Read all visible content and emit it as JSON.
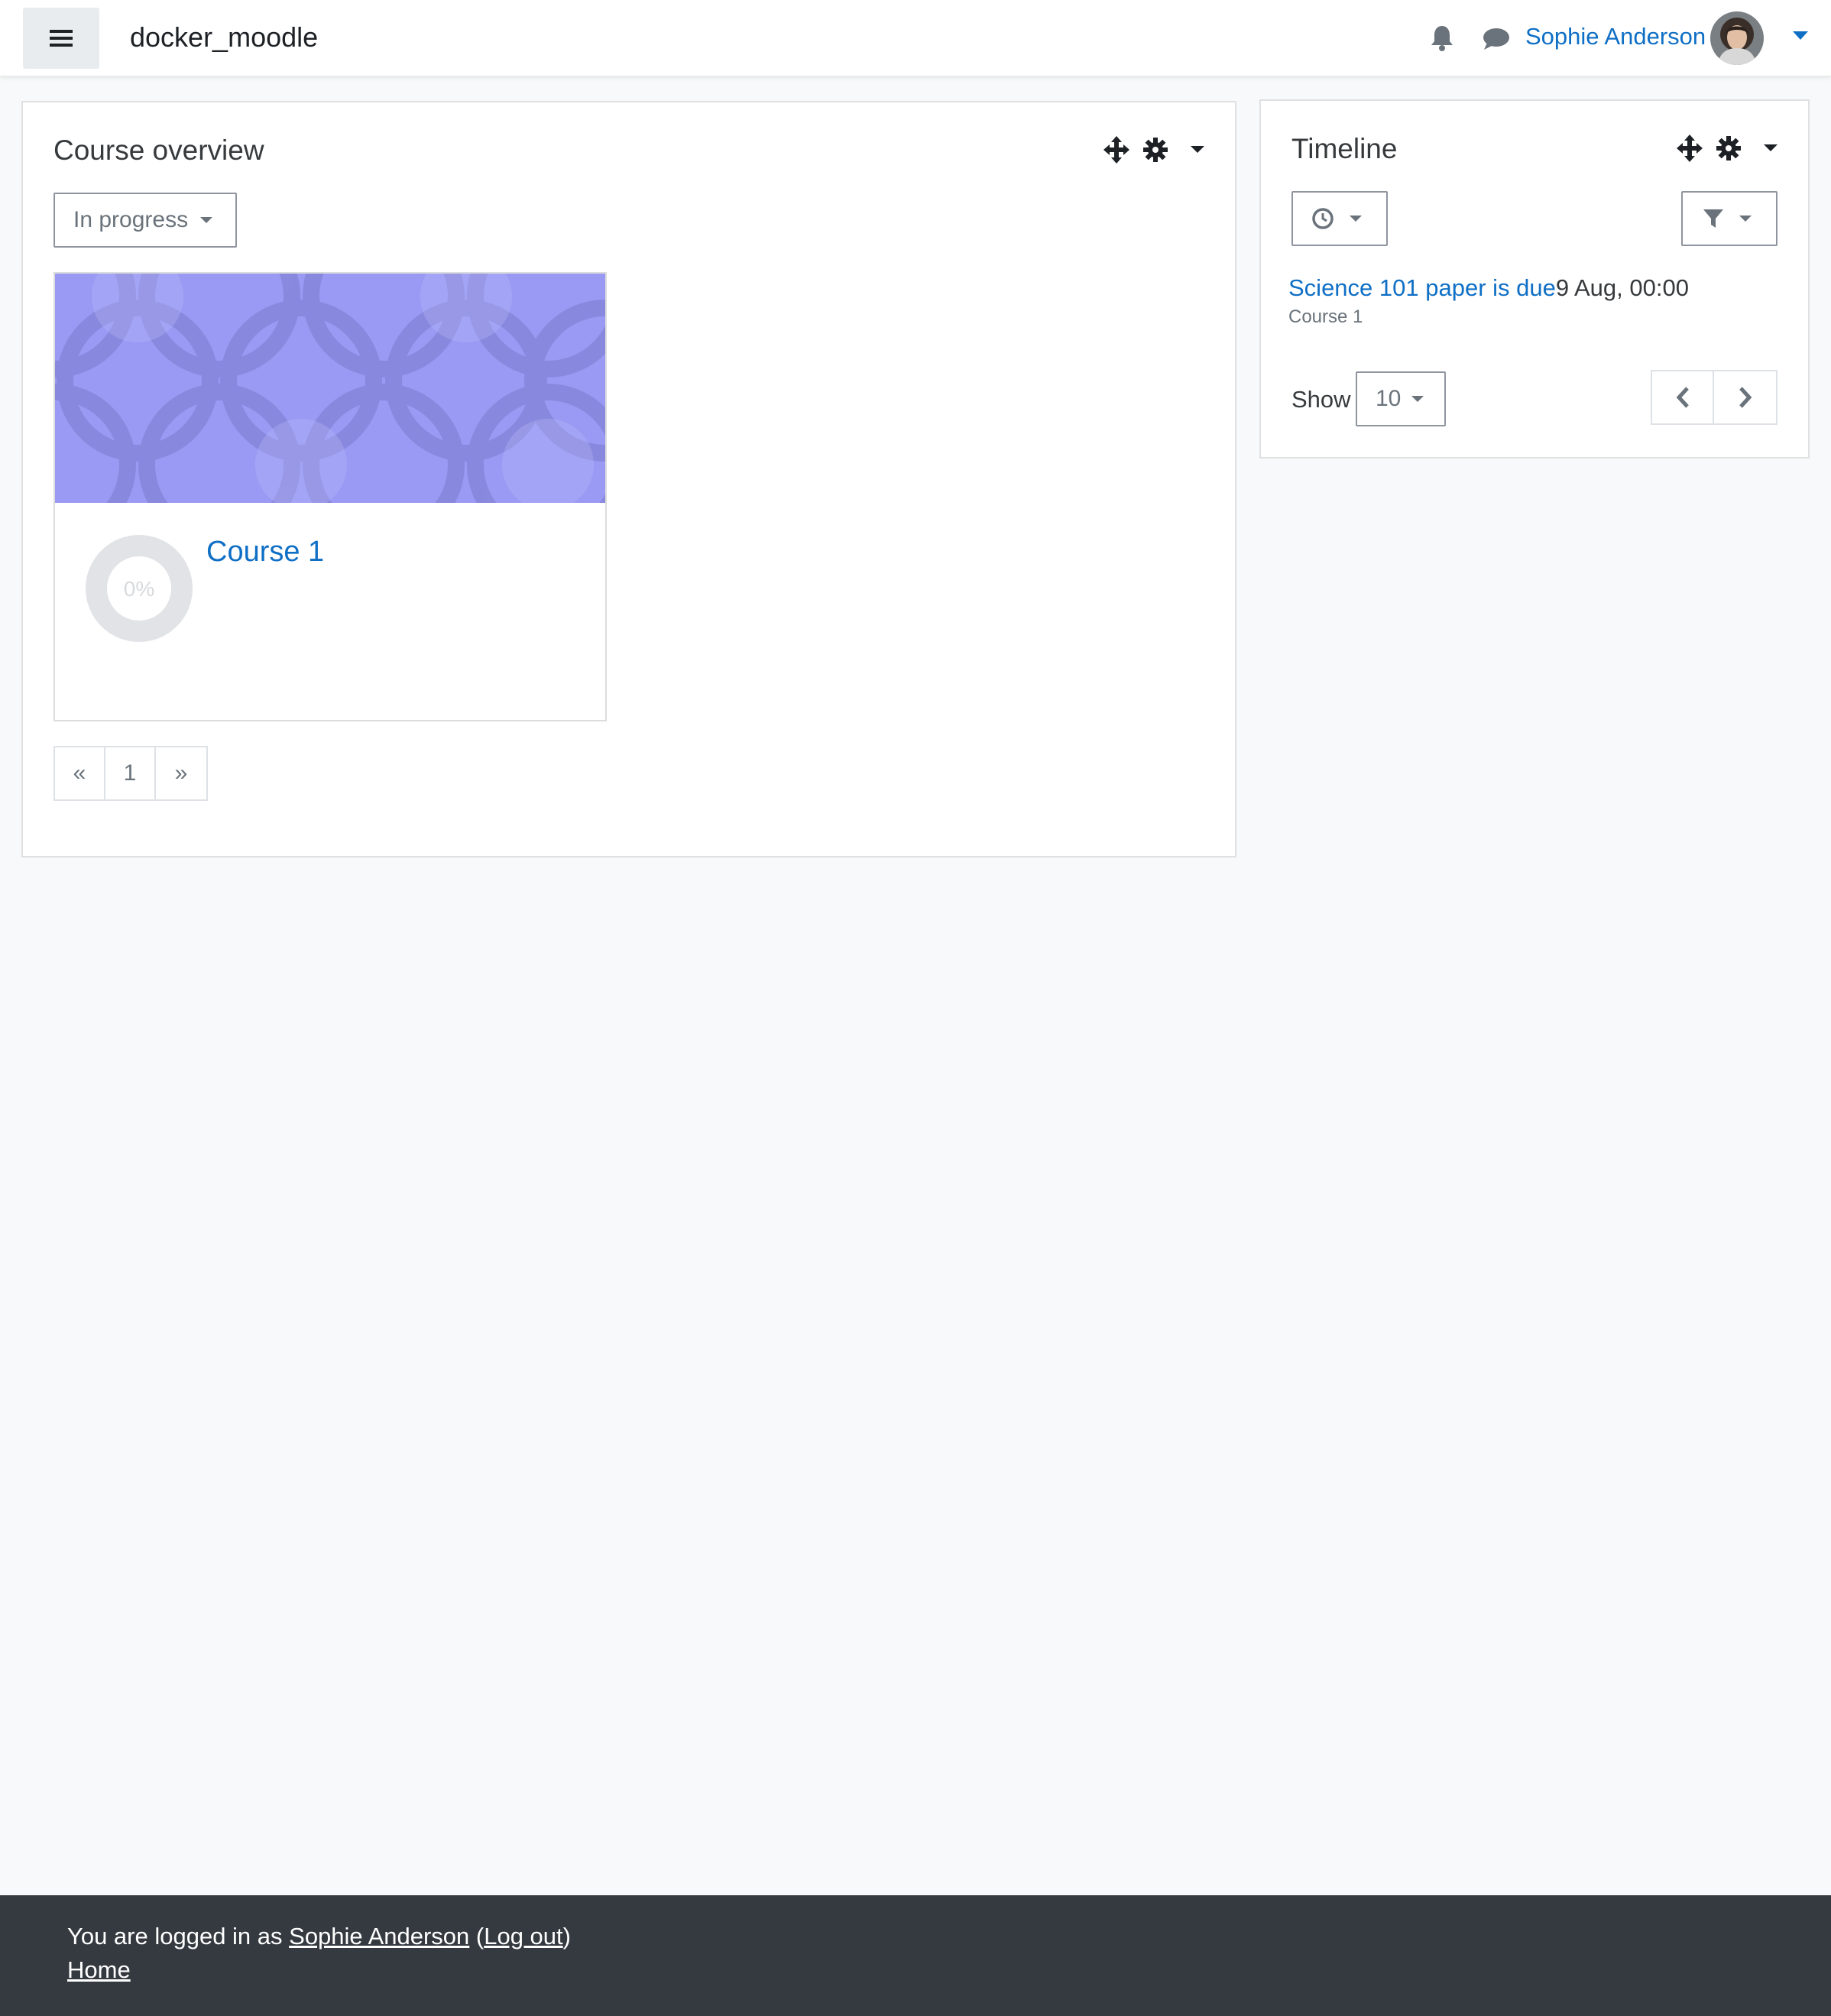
{
  "navbar": {
    "site_name": "docker_moodle",
    "user_name": "Sophie Anderson",
    "icons": [
      "menu-icon",
      "bell-icon",
      "chat-icon",
      "caret-down-icon"
    ]
  },
  "course_overview": {
    "title": "Course overview",
    "filter_label": "In progress",
    "courses": [
      {
        "name": "Course 1",
        "progress_label": "0%",
        "progress": 0
      }
    ],
    "pagination": {
      "prev": "«",
      "page": "1",
      "next": "»"
    }
  },
  "timeline": {
    "title": "Timeline",
    "event": {
      "name": "Science 101 paper is due",
      "date": "9 Aug, 00:00",
      "course": "Course 1"
    },
    "show_label": "Show",
    "show_value": "10"
  },
  "footer": {
    "logged_in_prefix": "You are logged in as ",
    "user_name": "Sophie Anderson",
    "open_paren": " (",
    "logout": "Log out",
    "close_paren": ")",
    "home": "Home"
  },
  "colors": {
    "link": "#0f6fc5",
    "footer_bg": "#343a40",
    "page_bg": "#f8f9fa",
    "course_image": "#9a9af4"
  }
}
